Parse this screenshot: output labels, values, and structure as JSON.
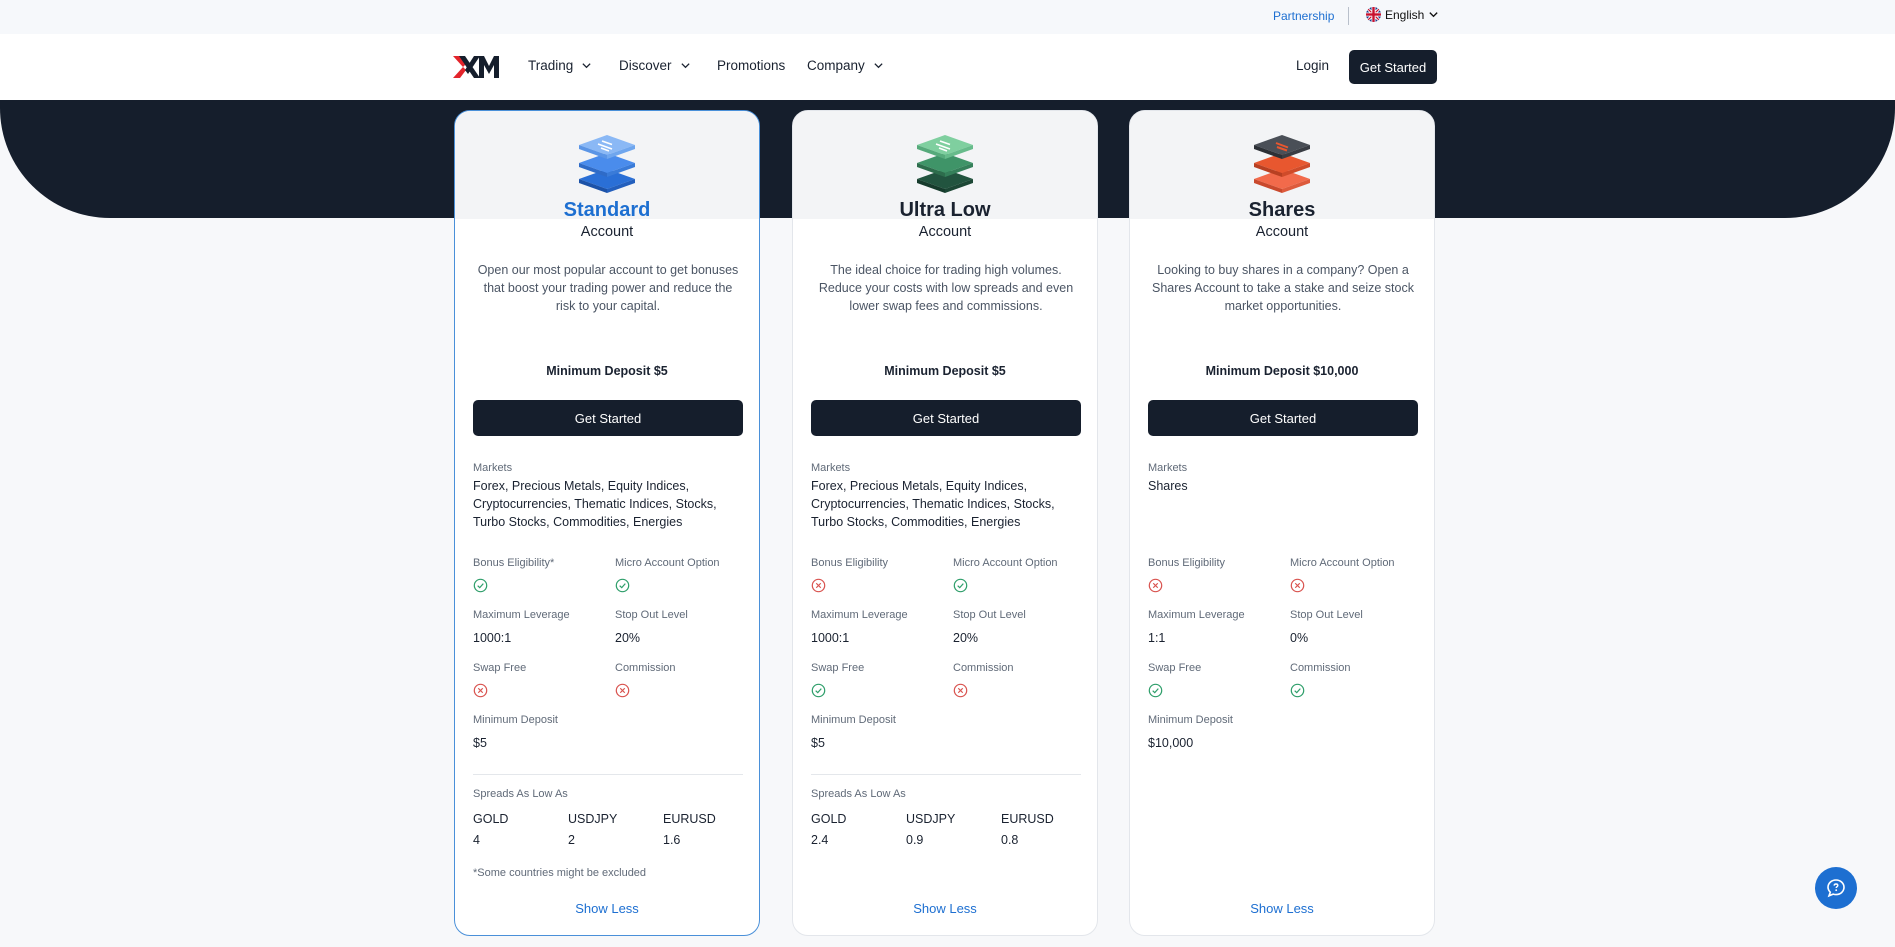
{
  "topbar": {
    "partnership": "Partnership",
    "language": "English"
  },
  "nav": {
    "items": [
      "Trading",
      "Discover",
      "Promotions",
      "Company"
    ],
    "login": "Login",
    "get_started": "Get Started"
  },
  "colors": {
    "dark": "#151e2c",
    "accent": "#1d6fd1",
    "check": "#2e9e6a",
    "cross": "#d9534f"
  },
  "cards": [
    {
      "title": "Standard",
      "subtitle": "Account",
      "description": "Open our most popular account to get bonuses that boost your trading power and reduce the risk to your capital.",
      "min_deposit_heading": "Minimum Deposit $5",
      "cta": "Get Started",
      "markets_label": "Markets",
      "markets": "Forex, Precious Metals, Equity Indices, Cryptocurrencies, Thematic Indices, Stocks, Turbo Stocks, Commodities, Energies",
      "bonus_label": "Bonus Eligibility*",
      "bonus": "check-icon",
      "micro_label": "Micro Account Option",
      "micro": "check-icon",
      "leverage_label": "Maximum Leverage",
      "leverage": "1000:1",
      "stopout_label": "Stop Out Level",
      "stopout": "20%",
      "swap_label": "Swap Free",
      "swap": "cross-icon",
      "commission_label": "Commission",
      "commission": "cross-icon",
      "mindep_label": "Minimum Deposit",
      "mindep": "$5",
      "spreads_label": "Spreads As Low As",
      "spreads": [
        {
          "name": "GOLD",
          "value": "4"
        },
        {
          "name": "USDJPY",
          "value": "2"
        },
        {
          "name": "EURUSD",
          "value": "1.6"
        }
      ],
      "note": "*Some countries might be excluded",
      "show_less": "Show Less"
    },
    {
      "title": "Ultra Low",
      "subtitle": "Account",
      "description": "The ideal choice for trading high volumes. Reduce your costs with low spreads and even lower swap fees and commissions.",
      "min_deposit_heading": "Minimum Deposit $5",
      "cta": "Get Started",
      "markets_label": "Markets",
      "markets": "Forex, Precious Metals, Equity Indices, Cryptocurrencies, Thematic Indices, Stocks, Turbo Stocks, Commodities, Energies",
      "bonus_label": "Bonus Eligibility",
      "bonus": "cross-icon",
      "micro_label": "Micro Account Option",
      "micro": "check-icon",
      "leverage_label": "Maximum Leverage",
      "leverage": "1000:1",
      "stopout_label": "Stop Out Level",
      "stopout": "20%",
      "swap_label": "Swap Free",
      "swap": "check-icon",
      "commission_label": "Commission",
      "commission": "cross-icon",
      "mindep_label": "Minimum Deposit",
      "mindep": "$5",
      "spreads_label": "Spreads As Low As",
      "spreads": [
        {
          "name": "GOLD",
          "value": "2.4"
        },
        {
          "name": "USDJPY",
          "value": "0.9"
        },
        {
          "name": "EURUSD",
          "value": "0.8"
        }
      ],
      "show_less": "Show Less"
    },
    {
      "title": "Shares",
      "subtitle": "Account",
      "description": "Looking to buy shares in a company? Open a Shares Account to take a stake and seize stock market opportunities.",
      "min_deposit_heading": "Minimum Deposit $10,000",
      "cta": "Get Started",
      "markets_label": "Markets",
      "markets": "Shares",
      "bonus_label": "Bonus Eligibility",
      "bonus": "cross-icon",
      "micro_label": "Micro Account Option",
      "micro": "cross-icon",
      "leverage_label": "Maximum Leverage",
      "leverage": "1:1",
      "stopout_label": "Stop Out Level",
      "stopout": "0%",
      "swap_label": "Swap Free",
      "swap": "check-icon",
      "commission_label": "Commission",
      "commission": "check-icon",
      "mindep_label": "Minimum Deposit",
      "mindep": "$10,000",
      "show_less": "Show Less"
    }
  ]
}
